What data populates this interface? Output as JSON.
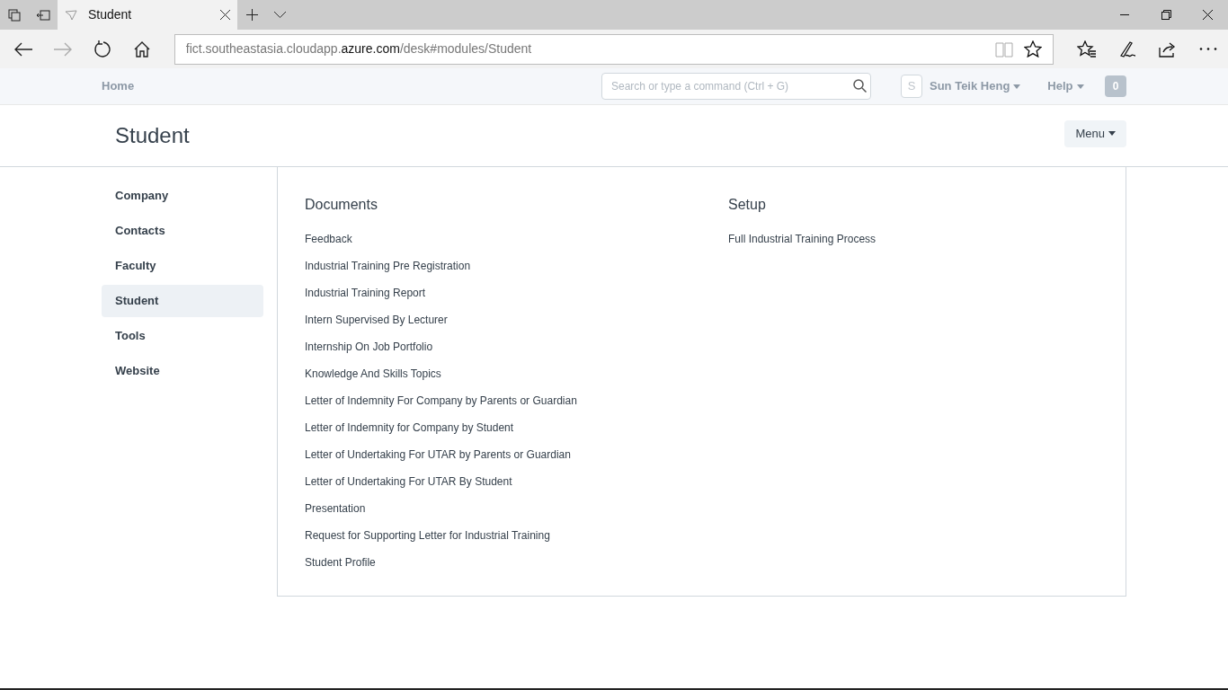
{
  "browser": {
    "tab": {
      "title": "Student"
    },
    "url": {
      "prefix": "fict.southeastasia.cloudapp.",
      "domain": "azure.com",
      "path": "/desk#modules/Student"
    }
  },
  "navbar": {
    "home": "Home",
    "search": {
      "placeholder": "Search or type a command (Ctrl + G)"
    },
    "avatar": "S",
    "user": "Sun Teik Heng",
    "help": "Help",
    "notifications": "0"
  },
  "page": {
    "title": "Student",
    "menu_button": "Menu"
  },
  "sidebar": {
    "items": [
      {
        "label": "Company",
        "selected": false
      },
      {
        "label": "Contacts",
        "selected": false
      },
      {
        "label": "Faculty",
        "selected": false
      },
      {
        "label": "Student",
        "selected": true
      },
      {
        "label": "Tools",
        "selected": false
      },
      {
        "label": "Website",
        "selected": false
      }
    ]
  },
  "sections": [
    {
      "title": "Documents",
      "links": [
        "Feedback",
        "Industrial Training Pre Registration",
        "Industrial Training Report",
        "Intern Supervised By Lecturer",
        "Internship On Job Portfolio",
        "Knowledge And Skills Topics",
        "Letter of Indemnity For Company by Parents or Guardian",
        "Letter of Indemnity for Company by Student",
        "Letter of Undertaking For UTAR by Parents or Guardian",
        "Letter of Undertaking For UTAR By Student",
        "Presentation",
        "Request for Supporting Letter for Industrial Training",
        "Student Profile"
      ]
    },
    {
      "title": "Setup",
      "links": [
        "Full Industrial Training Process"
      ]
    }
  ]
}
